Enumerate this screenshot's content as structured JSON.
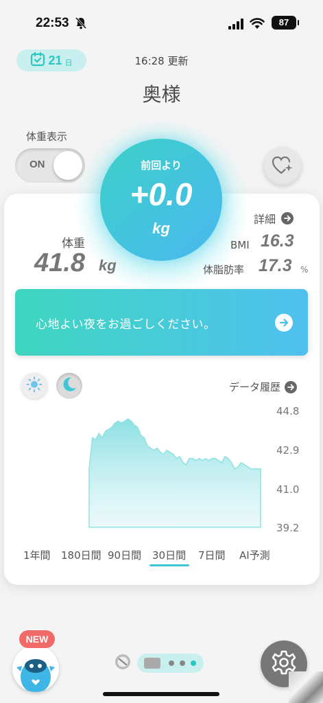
{
  "status_bar": {
    "time": "22:53",
    "battery": "87"
  },
  "header": {
    "date_chip": {
      "number": "21",
      "unit": "日"
    },
    "updated": "16:28 更新",
    "title": "奥様"
  },
  "toggle": {
    "label": "体重表示",
    "state": "ON"
  },
  "circle": {
    "label": "前回より",
    "value": "+0.0",
    "unit": "kg"
  },
  "stats": {
    "weight_label": "体重",
    "weight_value": "41.8",
    "weight_unit": "kg",
    "detail_link": "詳細",
    "bmi_label": "BMI",
    "bmi_value": "16.3",
    "fat_label": "体脂肪率",
    "fat_value": "17.3",
    "fat_unit": "%"
  },
  "banner": {
    "text": "心地よい夜をお過ごしください。"
  },
  "history_link": "データ履歴",
  "chart_data": {
    "type": "area",
    "ylim": [
      39.2,
      44.8
    ],
    "yticks": [
      "44.8",
      "42.9",
      "41.0",
      "39.2"
    ],
    "values": [
      42.0,
      43.5,
      43.4,
      43.7,
      43.5,
      43.8,
      43.9,
      44.0,
      44.2,
      44.3,
      44.2,
      44.3,
      44.4,
      44.3,
      44.1,
      44.0,
      43.6,
      43.5,
      43.1,
      43.0,
      42.9,
      43.0,
      42.8,
      42.7,
      42.9,
      42.8,
      42.7,
      42.5,
      42.6,
      42.3,
      42.2,
      42.5,
      42.5,
      42.4,
      42.5,
      42.4,
      42.5,
      42.4,
      42.5,
      42.5,
      42.4,
      42.3,
      42.6,
      42.5,
      42.3,
      42.0,
      42.1,
      42.3,
      42.2,
      42.1,
      42.0,
      42.0,
      42.0,
      42.0
    ],
    "color": "#7fdde0",
    "grid": false,
    "legend": "none"
  },
  "range_tabs": [
    {
      "label": "1年間"
    },
    {
      "label": "180日間"
    },
    {
      "label": "90日間"
    },
    {
      "label": "30日間",
      "selected": true
    },
    {
      "label": "7日間"
    },
    {
      "label": "AI予測"
    }
  ],
  "bottom": {
    "new_badge": "NEW"
  },
  "colors": {
    "accent": "#3ec8d6",
    "gradient_start": "#3cd0c8",
    "gradient_end": "#4ab8f0",
    "badge": "#f06a6a"
  },
  "icons": [
    "bell-slash-icon",
    "signal-icon",
    "wifi-icon",
    "calendar-icon",
    "heart-sparkle-icon",
    "arrow-right-icon",
    "sun-icon",
    "moon-icon",
    "gear-icon",
    "mascot-icon"
  ]
}
